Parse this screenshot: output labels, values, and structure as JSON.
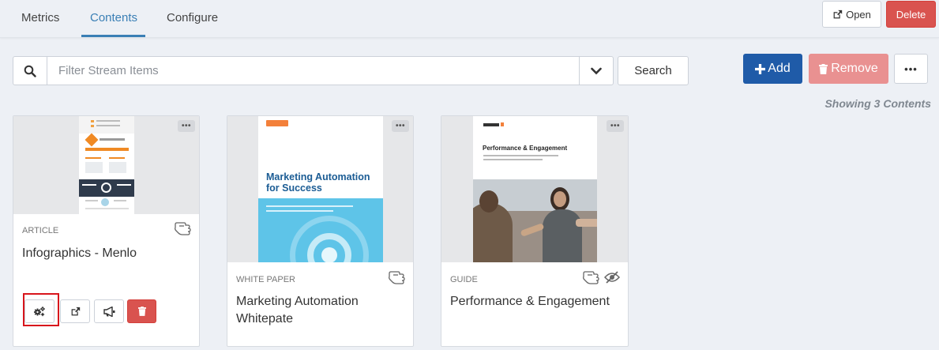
{
  "tabs": [
    {
      "label": "Metrics"
    },
    {
      "label": "Contents"
    },
    {
      "label": "Configure"
    }
  ],
  "header": {
    "open_label": "Open",
    "delete_label": "Delete"
  },
  "filter": {
    "placeholder": "Filter Stream Items",
    "search_label": "Search"
  },
  "toolbar": {
    "add_label": "Add",
    "remove_label": "Remove",
    "more_label": "•••"
  },
  "showing_text": "Showing 3 Contents",
  "cards": [
    {
      "type": "ARTICLE",
      "title": "Infographics - Menlo",
      "more_label": "•••"
    },
    {
      "type": "WHITE PAPER",
      "title": "Marketing Automation Whitepate",
      "more_label": "•••",
      "thumb_title_line1": "Marketing Automation",
      "thumb_title_line2": "for Success"
    },
    {
      "type": "GUIDE",
      "title": "Performance & Engagement",
      "more_label": "•••",
      "thumb_title": "Performance & Engagement"
    }
  ],
  "colors": {
    "accent": "#3a7fb5",
    "primary": "#1f5ba8",
    "danger": "#d9534f",
    "danger_disabled": "#e99191",
    "highlight": "#d8151c"
  }
}
